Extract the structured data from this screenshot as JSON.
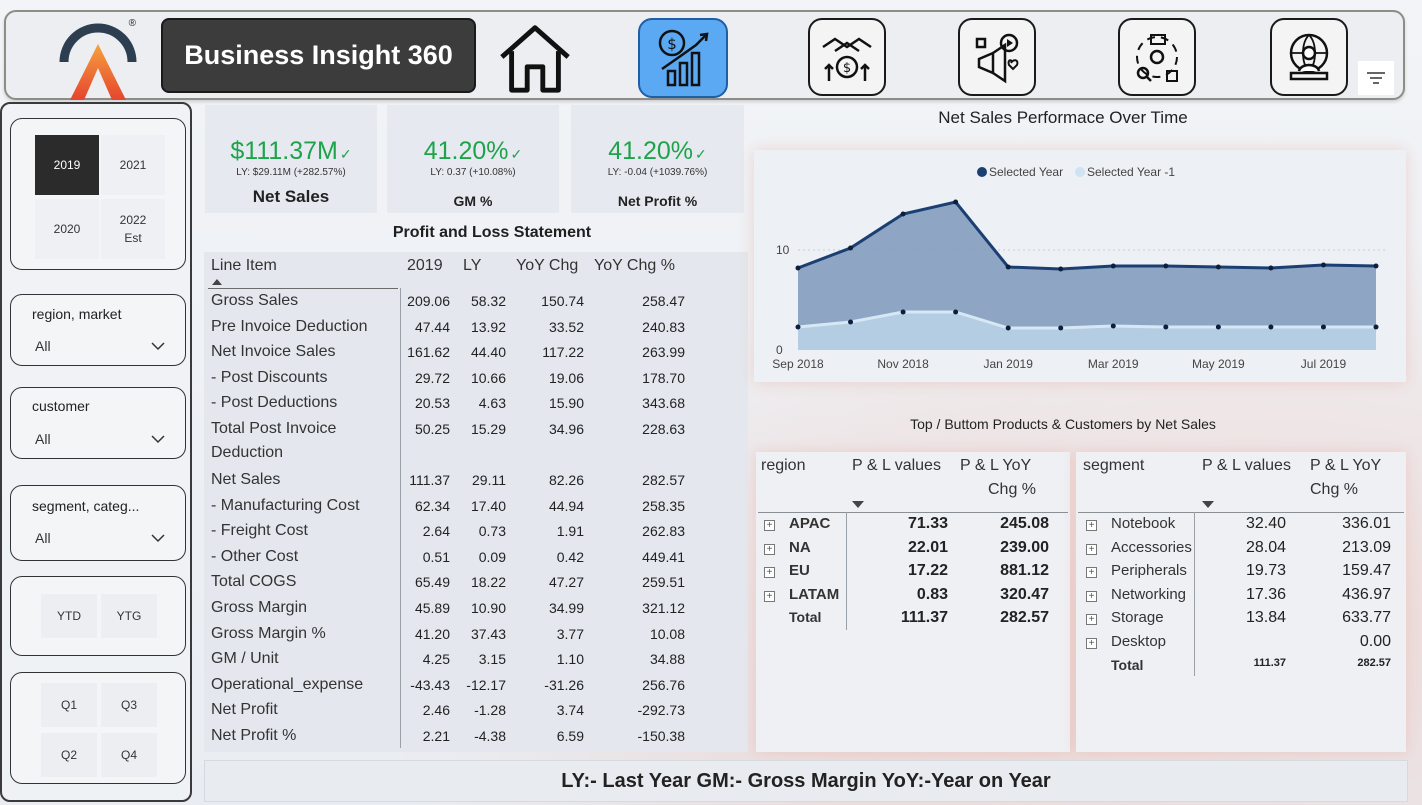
{
  "app": {
    "title": "Business Insight 360",
    "logo_mark": "®"
  },
  "nav": [
    {
      "name": "home-icon"
    },
    {
      "name": "finance-icon",
      "active": true
    },
    {
      "name": "sales-icon"
    },
    {
      "name": "marketing-icon"
    },
    {
      "name": "supply-chain-icon"
    },
    {
      "name": "executive-icon"
    }
  ],
  "filters": {
    "years": [
      {
        "label": "2019",
        "selected": true
      },
      {
        "label": "2021"
      },
      {
        "label": "2020"
      },
      {
        "label": "2022",
        "sub": "Est"
      }
    ],
    "region": {
      "label": "region, market",
      "value": "All"
    },
    "customer": {
      "label": "customer",
      "value": "All"
    },
    "segment": {
      "label": "segment, categ...",
      "value": "All"
    },
    "period": [
      "YTD",
      "YTG"
    ],
    "quarters": [
      "Q1",
      "Q3",
      "Q2",
      "Q4"
    ]
  },
  "kpis": [
    {
      "value": "$111.37M",
      "ly": "LY: $29.11M (+282.57%)",
      "label": "Net Sales"
    },
    {
      "value": "41.20%",
      "ly": "LY: 0.37 (+10.08%)",
      "label": "GM %"
    },
    {
      "value": "41.20%",
      "ly": "LY: -0.04 (+1039.76%)",
      "label": "Net Profit %"
    }
  ],
  "pl": {
    "title": "Profit and Loss Statement",
    "headers": [
      "Line Item",
      "2019",
      "LY",
      "YoY Chg",
      "YoY Chg %"
    ],
    "rows": [
      {
        "item": "Gross Sales",
        "y": "209.06",
        "ly": "58.32",
        "chg": "150.74",
        "pct": "258.47"
      },
      {
        "item": "Pre Invoice Deduction",
        "y": "47.44",
        "ly": "13.92",
        "chg": "33.52",
        "pct": "240.83"
      },
      {
        "item": "Net Invoice Sales",
        "y": "161.62",
        "ly": "44.40",
        "chg": "117.22",
        "pct": "263.99"
      },
      {
        "item": "- Post Discounts",
        "y": "29.72",
        "ly": "10.66",
        "chg": "19.06",
        "pct": "178.70"
      },
      {
        "item": "- Post Deductions",
        "y": "20.53",
        "ly": "4.63",
        "chg": "15.90",
        "pct": "343.68"
      },
      {
        "item": "Total Post Invoice",
        "item2": "Deduction",
        "y": "50.25",
        "ly": "15.29",
        "chg": "34.96",
        "pct": "228.63"
      },
      {
        "item": "Net Sales",
        "y": "111.37",
        "ly": "29.11",
        "chg": "82.26",
        "pct": "282.57"
      },
      {
        "item": "- Manufacturing Cost",
        "y": "62.34",
        "ly": "17.40",
        "chg": "44.94",
        "pct": "258.35"
      },
      {
        "item": "- Freight Cost",
        "y": "2.64",
        "ly": "0.73",
        "chg": "1.91",
        "pct": "262.83"
      },
      {
        "item": "- Other Cost",
        "y": "0.51",
        "ly": "0.09",
        "chg": "0.42",
        "pct": "449.41"
      },
      {
        "item": "Total COGS",
        "y": "65.49",
        "ly": "18.22",
        "chg": "47.27",
        "pct": "259.51"
      },
      {
        "item": "Gross Margin",
        "y": "45.89",
        "ly": "10.90",
        "chg": "34.99",
        "pct": "321.12"
      },
      {
        "item": "Gross Margin %",
        "y": "41.20",
        "ly": "37.43",
        "chg": "3.77",
        "pct": "10.08"
      },
      {
        "item": "GM / Unit",
        "y": "4.25",
        "ly": "3.15",
        "chg": "1.10",
        "pct": "34.88"
      },
      {
        "item": "Operational_expense",
        "y": "-43.43",
        "ly": "-12.17",
        "chg": "-31.26",
        "pct": "256.76"
      },
      {
        "item": "Net Profit",
        "y": "2.46",
        "ly": "-1.28",
        "chg": "3.74",
        "pct": "-292.73"
      },
      {
        "item": "Net Profit %",
        "y": "2.21",
        "ly": "-4.38",
        "chg": "6.59",
        "pct": "-150.38"
      }
    ]
  },
  "chart_data": {
    "type": "area",
    "title": "Net Sales Performace Over Time",
    "x": [
      "Sep 2018",
      "Oct 2018",
      "Nov 2018",
      "Dec 2018",
      "Jan 2019",
      "Feb 2019",
      "Mar 2019",
      "Apr 2019",
      "May 2019",
      "Jun 2019",
      "Jul 2019",
      "Aug 2019"
    ],
    "x_ticks": [
      "Sep 2018",
      "Nov 2018",
      "Jan 2019",
      "Mar 2019",
      "May 2019",
      "Jul 2019"
    ],
    "y_ticks": [
      "0",
      "10"
    ],
    "ylim": [
      0,
      16
    ],
    "series": [
      {
        "name": "Selected Year",
        "color": "#1b3f73",
        "values": [
          8.2,
          10.2,
          13.6,
          14.8,
          8.3,
          8.1,
          8.4,
          8.4,
          8.3,
          8.2,
          8.5,
          8.4
        ]
      },
      {
        "name": "Selected Year -1",
        "color": "#cfe3f3",
        "values": [
          2.3,
          2.8,
          3.8,
          3.8,
          2.2,
          2.2,
          2.4,
          2.3,
          2.3,
          2.3,
          2.3,
          2.3
        ]
      }
    ],
    "legend_position": "top"
  },
  "bottom_title": "Top / Buttom Products & Customers by Net Sales",
  "region_table": {
    "headers": [
      "region",
      "P & L values",
      "P & L YoY",
      "Chg %"
    ],
    "rows": [
      {
        "label": "APAC",
        "val": "71.33",
        "chg": "245.08"
      },
      {
        "label": "NA",
        "val": "22.01",
        "chg": "239.00"
      },
      {
        "label": "EU",
        "val": "17.22",
        "chg": "881.12"
      },
      {
        "label": "LATAM",
        "val": "0.83",
        "chg": "320.47"
      }
    ],
    "total": {
      "label": "Total",
      "val": "111.37",
      "chg": "282.57"
    }
  },
  "segment_table": {
    "headers": [
      "segment",
      "P & L values",
      "P & L YoY",
      "Chg %"
    ],
    "rows": [
      {
        "label": "Notebook",
        "val": "32.40",
        "chg": "336.01"
      },
      {
        "label": "Accessories",
        "val": "28.04",
        "chg": "213.09"
      },
      {
        "label": "Peripherals",
        "val": "19.73",
        "chg": "159.47"
      },
      {
        "label": "Networking",
        "val": "17.36",
        "chg": "436.97"
      },
      {
        "label": "Storage",
        "val": "13.84",
        "chg": "633.77"
      },
      {
        "label": "Desktop",
        "val": "",
        "chg": "0.00"
      }
    ],
    "total": {
      "label": "Total",
      "val": "111.37",
      "chg": "282.57"
    }
  },
  "footer": "LY:- Last Year GM:- Gross Margin YoY:-Year on Year"
}
